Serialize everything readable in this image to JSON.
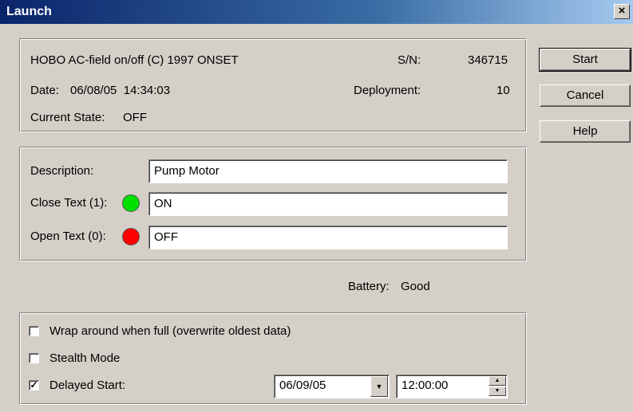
{
  "window": {
    "title": "Launch",
    "close_glyph": "×"
  },
  "device": {
    "name": "HOBO AC-field on/off (C) 1997 ONSET",
    "sn_label": "S/N:",
    "sn_value": "346715",
    "date_label": "Date:",
    "date_value": "06/08/05  14:34:03",
    "deployment_label": "Deployment:",
    "deployment_value": "10",
    "state_label": "Current State:",
    "state_value": "OFF"
  },
  "buttons": {
    "start": "Start",
    "cancel": "Cancel",
    "help": "Help"
  },
  "fields": {
    "description_label": "Description:",
    "description_value": "Pump Motor",
    "close_label": "Close Text (1):",
    "close_value": "ON",
    "close_led_color": "#00e000",
    "open_label": "Open Text (0):",
    "open_value": "OFF",
    "open_led_color": "#ff0000"
  },
  "battery": {
    "label": "Battery:",
    "value": "Good"
  },
  "options": {
    "wrap_label": "Wrap around when full (overwrite oldest data)",
    "wrap_checked": false,
    "stealth_label": "Stealth Mode",
    "stealth_checked": false,
    "delayed_label": "Delayed Start:",
    "delayed_checked": true,
    "check_glyph": "✓",
    "date_value": "06/09/05",
    "time_value": "12:00:00"
  },
  "icons": {
    "close": "close-icon",
    "dropdown": "chevron-down-icon",
    "spin_up": "spin-up-icon",
    "spin_down": "spin-down-icon"
  },
  "colors": {
    "titlebar_start": "#0a246a",
    "titlebar_end": "#a6caf0",
    "face": "#d4d0c8"
  }
}
